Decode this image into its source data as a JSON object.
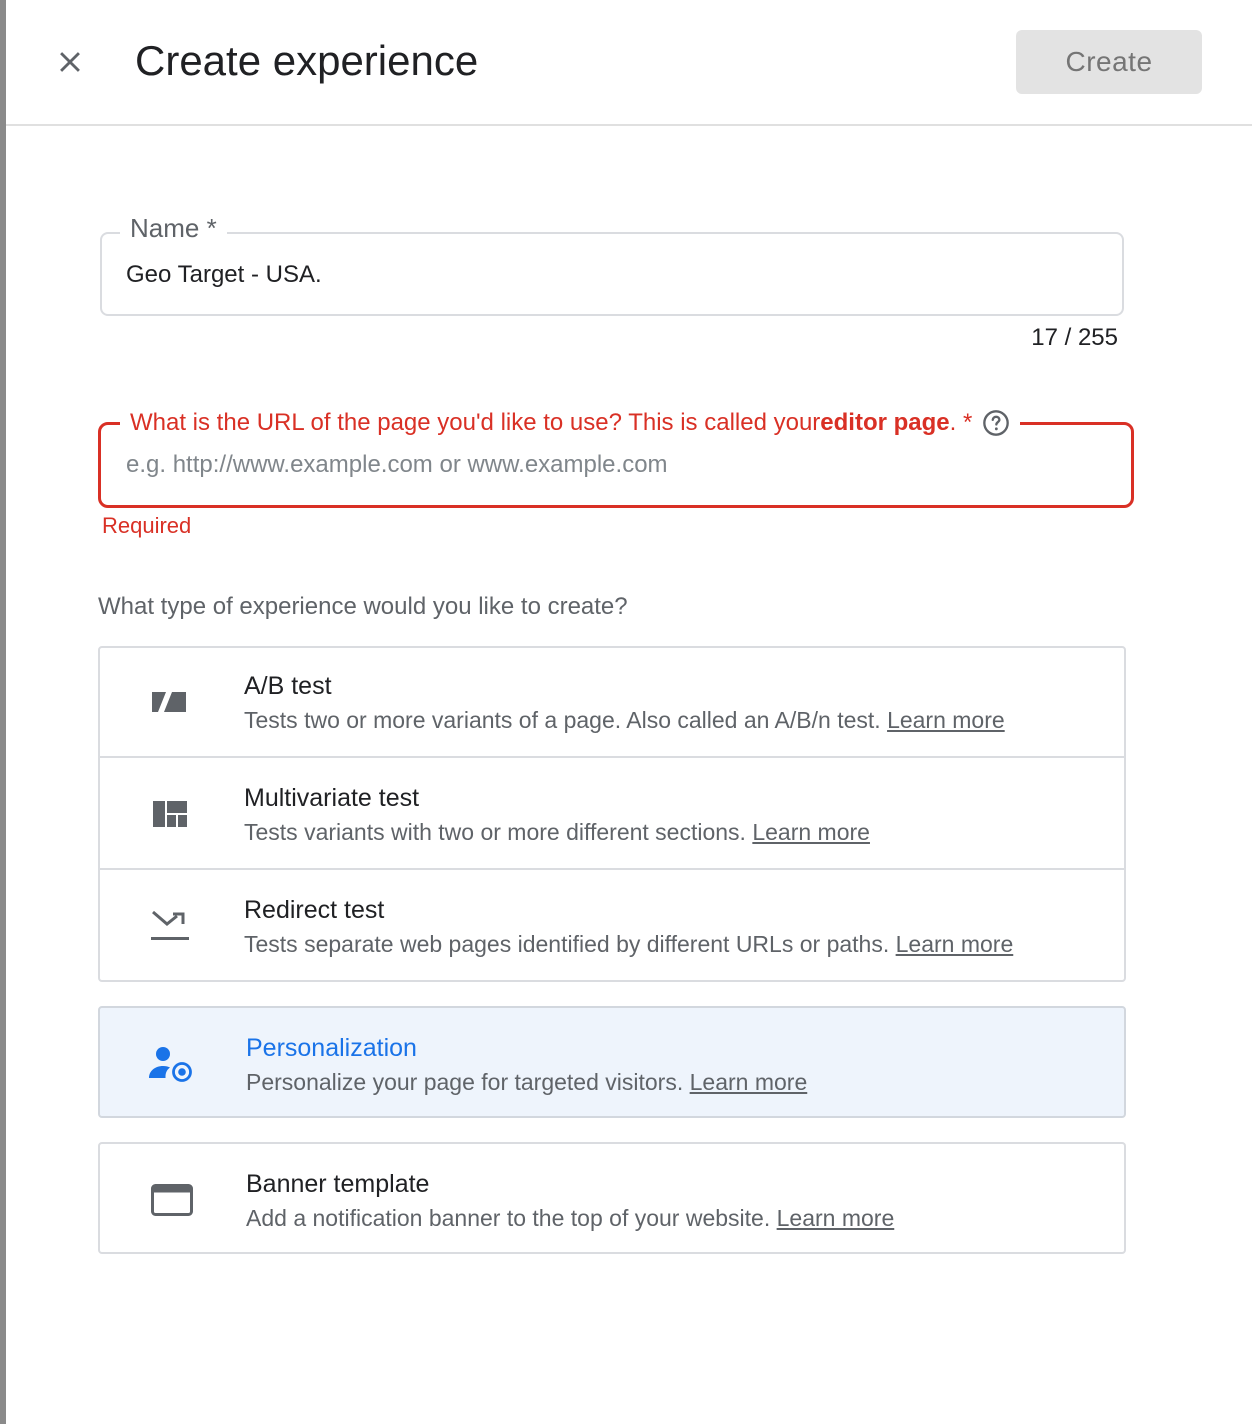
{
  "header": {
    "title": "Create experience",
    "create_label": "Create"
  },
  "name_field": {
    "label": "Name *",
    "value": "Geo Target - USA.",
    "counter": "17 / 255"
  },
  "url_field": {
    "label_prefix": "What is the URL of the page you'd like to use? This is called your ",
    "label_bold": "editor page",
    "label_suffix": ". *",
    "placeholder": "e.g. http://www.example.com or www.example.com",
    "error": "Required"
  },
  "type_question": "What type of experience would you like to create?",
  "options": [
    {
      "title": "A/B test",
      "desc": "Tests two or more variants of a page. Also called an A/B/n test.",
      "learn_more": "Learn more",
      "icon": "ab-test-icon"
    },
    {
      "title": "Multivariate test",
      "desc": "Tests variants with two or more different sections.",
      "learn_more": "Learn more",
      "icon": "multivariate-icon"
    },
    {
      "title": "Redirect test",
      "desc": "Tests separate web pages identified by different URLs or paths.",
      "learn_more": "Learn more",
      "icon": "redirect-icon"
    },
    {
      "title": "Personalization",
      "desc": "Personalize your page for targeted visitors.",
      "learn_more": "Learn more",
      "icon": "personalization-icon",
      "selected": true
    },
    {
      "title": "Banner template",
      "desc": "Add a notification banner to the top of your website.",
      "learn_more": "Learn more",
      "icon": "banner-icon"
    }
  ],
  "colors": {
    "error": "#d93025",
    "accent": "#1a73e8",
    "selected_bg": "#eef4fc",
    "icon_gray": "#5f6368"
  }
}
